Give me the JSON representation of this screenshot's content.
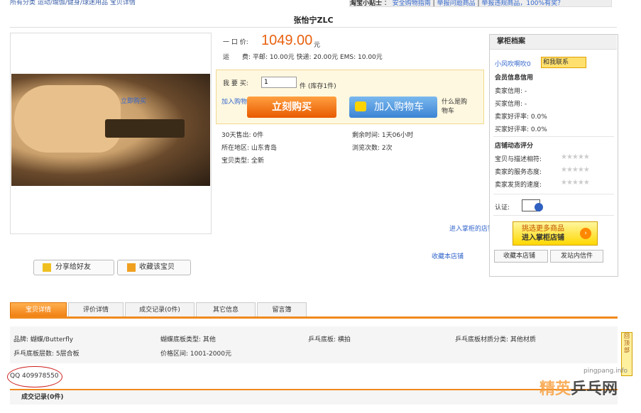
{
  "top": {
    "crumb": "所有分类 运动/瑜伽/健身/球迷用品 宝贝详情",
    "tip_title": "淘宝小贴士",
    "tip_links": [
      "安全购物指南",
      "举报问题商品",
      "举报违规商品，100%有奖？"
    ]
  },
  "product": {
    "title": "张怡宁ZLC",
    "image_link": "立即购买",
    "price_label": "一 口 价:",
    "price": "1049.00",
    "currency": "元",
    "ship_label": "运　　费:",
    "ship_info": "平邮: 10.00元 快递: 20.00元 EMS: 10.00元",
    "buy_label": "我 要 买:",
    "quantity": "1",
    "stock_note": "件 (库存1件)",
    "add_cart_link": "加入购物车",
    "buy_now_btn": "立刻购买",
    "add_cart_btn": "加入购物车",
    "what_is_cart": "什么是购物车",
    "sold_30": "30天售出: 0件",
    "remaining": "剩余时间: 1天06小时",
    "location": "所在地区: 山东青岛",
    "views": "浏览次数: 2次",
    "item_type": "宝贝类型: 全新",
    "enter_store": "进入掌柜的店铺",
    "fav_store": "收藏本店铺",
    "share_btn": "分享给好友",
    "collect_btn": "收藏该宝贝"
  },
  "sidebar": {
    "title": "掌柜档案",
    "seller": "小风吹啊吹0",
    "contact": "和我联系",
    "member_title": "会员信息信用",
    "seller_credit": "卖家信用: -",
    "buyer_credit": "买家信用: -",
    "seller_good": "卖家好评率: 0.0%",
    "buyer_good": "买家好评率: 0.0%",
    "rating_title": "店铺动态评分",
    "rating_1": "宝贝与描述相符:",
    "rating_2": "卖家的服务态度:",
    "rating_3": "卖家发货的速度:",
    "stars": "★★★★★",
    "auth_label": "认证:",
    "pick_l1": "挑选更多商品",
    "pick_l2": "进入掌柜店铺",
    "fav_btn": "收藏本店铺",
    "msg_btn": "发站内信件"
  },
  "tabs": [
    "宝贝详情",
    "评价详情",
    "成交记录(0件)",
    "其它信息",
    "留言簿"
  ],
  "attributes": [
    "品牌: 蝴蝶/Butterfly",
    "蝴蝶底板类型: 其他",
    "乒乓底板: 横拍",
    "乒乓底板材质分类: 其他材质",
    "乒乓底板层数: 5层合板",
    "价格区间: 1001-2000元"
  ],
  "qq": "QQ 409978550",
  "records_title": "成交记录(0件)",
  "to_top": "回顶部",
  "watermark": {
    "url": "pingpang.info",
    "logo_a": "精英",
    "logo_b": "乒乓网"
  },
  "colors": {
    "price": "#e8610f",
    "accent": "#f08a1c",
    "link": "#3366cc"
  }
}
